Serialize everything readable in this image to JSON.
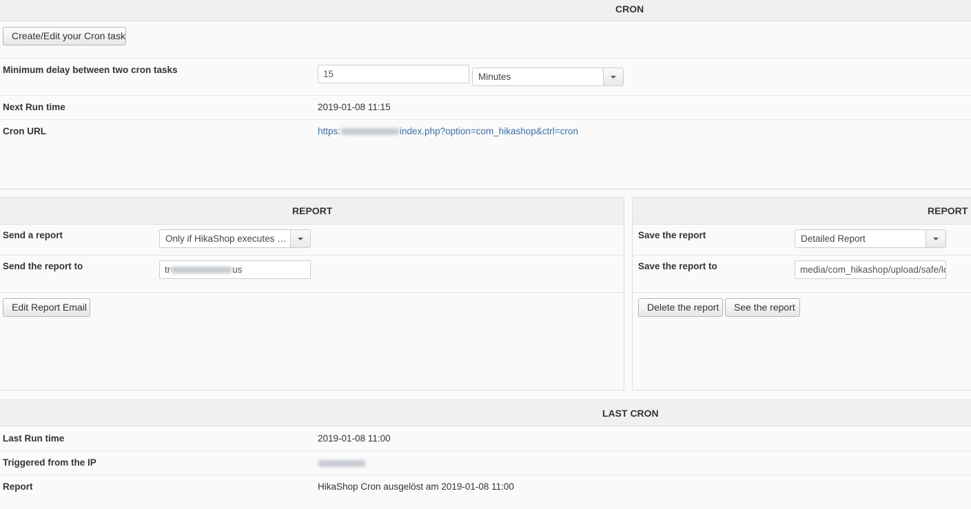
{
  "cron": {
    "title": "CRON",
    "create_button": "Create/Edit your Cron task",
    "min_delay_label": "Minimum delay between two cron tasks",
    "min_delay_value": "15",
    "min_delay_unit": "Minutes",
    "next_run_label": "Next Run time",
    "next_run_value": "2019-01-08 11:15",
    "url_label": "Cron URL",
    "url_prefix": "https:",
    "url_suffix": "index.php?option=com_hikashop&ctrl=cron"
  },
  "report_left": {
    "title": "REPORT",
    "send_label": "Send a report",
    "send_value": "Only if HikaShop executes an...",
    "send_to_label": "Send the report to",
    "send_to_prefix": "tr",
    "send_to_suffix": "us",
    "edit_button": "Edit Report Email"
  },
  "report_right": {
    "title": "REPORT",
    "save_label": "Save the report",
    "save_value": "Detailed Report",
    "save_to_label": "Save the report to",
    "save_to_value": "media/com_hikashop/upload/safe/lo",
    "delete_button": "Delete the report",
    "see_button": "See the report"
  },
  "last_cron": {
    "title": "LAST CRON",
    "last_run_label": "Last Run time",
    "last_run_value": "2019-01-08 11:00",
    "ip_label": "Triggered from the IP",
    "report_label": "Report",
    "report_value": "HikaShop Cron ausgelöst am 2019-01-08 11:00"
  }
}
